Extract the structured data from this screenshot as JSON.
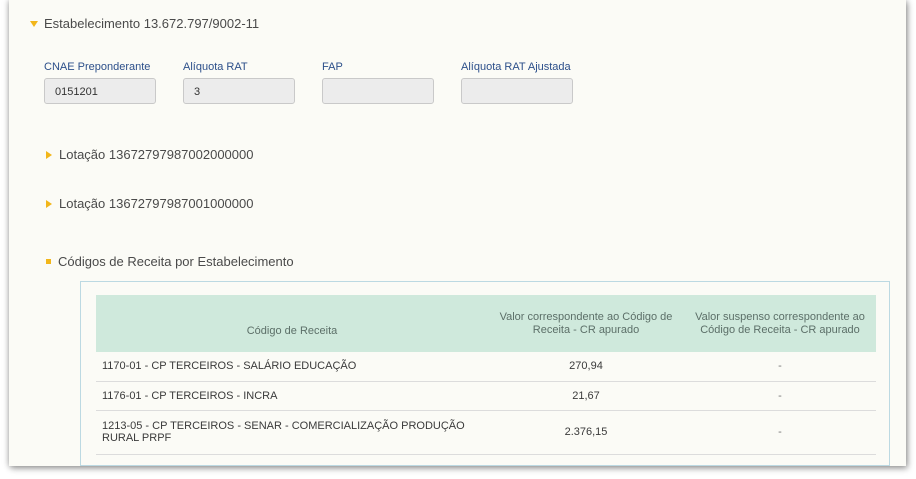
{
  "estabelecimento": {
    "title": "Estabelecimento 13.672.797/9002-11",
    "fields": [
      {
        "label": "CNAE Preponderante",
        "value": "0151201"
      },
      {
        "label": "Alíquota RAT",
        "value": "3"
      },
      {
        "label": "FAP",
        "value": ""
      },
      {
        "label": "Alíquota RAT Ajustada",
        "value": ""
      }
    ]
  },
  "lotacoes": [
    {
      "title": "Lotação 13672797987002000000"
    },
    {
      "title": "Lotação 13672797987001000000"
    }
  ],
  "codigos": {
    "title": "Códigos de Receita por Estabelecimento",
    "headers": [
      "Código de Receita",
      "Valor correspondente ao Código de Receita - CR apurado",
      "Valor suspenso correspondente ao Código de Receita - CR apurado"
    ],
    "rows": [
      {
        "codigo": "1170-01 - CP TERCEIROS - SALÁRIO EDUCAÇÃO",
        "valor": "270,94",
        "suspenso": "-"
      },
      {
        "codigo": "1176-01 - CP TERCEIROS - INCRA",
        "valor": "21,67",
        "suspenso": "-"
      },
      {
        "codigo": "1213-05 - CP TERCEIROS - SENAR - COMERCIALIZAÇÃO PRODUÇÃO RURAL PRPF",
        "valor": "2.376,15",
        "suspenso": "-"
      }
    ]
  },
  "colors": {
    "accent": "#f2b61a",
    "label": "#2c4f8a",
    "header_bg": "#cfe9dc"
  }
}
